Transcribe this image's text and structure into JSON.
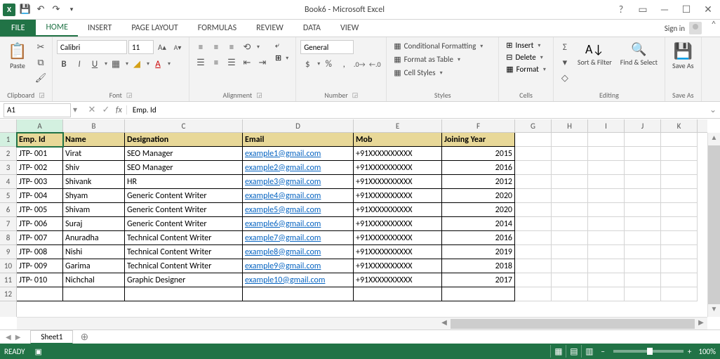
{
  "title": "Book6 - Microsoft Excel",
  "qat": {
    "excel": "X⁺",
    "undo": "↶",
    "redo": "↷"
  },
  "titleright": {
    "help": "?",
    "ribbon": "▭",
    "min": "—",
    "max": "☐",
    "close": "✕"
  },
  "tabs": {
    "file": "FILE",
    "items": [
      "HOME",
      "INSERT",
      "PAGE LAYOUT",
      "FORMULAS",
      "REVIEW",
      "DATA",
      "VIEW"
    ],
    "active": "HOME",
    "signin": "Sign in",
    "collapse": "^"
  },
  "ribbon": {
    "clipboard": {
      "paste": "Paste",
      "label": "Clipboard"
    },
    "font": {
      "name": "Calibri",
      "size": "11",
      "bold": "B",
      "italic": "I",
      "underline": "U",
      "grow": "A▴",
      "shrink": "A▾",
      "label": "Font"
    },
    "alignment": {
      "wrap": "Wrap",
      "merge": "Merge",
      "label": "Alignment"
    },
    "number": {
      "format": "General",
      "label": "Number"
    },
    "styles": {
      "cond": "Conditional Formatting",
      "table": "Format as Table",
      "cell": "Cell Styles",
      "label": "Styles"
    },
    "cells": {
      "insert": "Insert",
      "delete": "Delete",
      "format": "Format",
      "label": "Cells"
    },
    "editing": {
      "sort": "Sort & Filter",
      "find": "Find & Select",
      "label": "Editing"
    },
    "saveas": {
      "btn": "Save As",
      "label": "Save As"
    }
  },
  "formula_bar": {
    "namebox": "A1",
    "content": "Emp. Id"
  },
  "columns": [
    "A",
    "B",
    "C",
    "D",
    "E",
    "F",
    "G",
    "H",
    "I",
    "J",
    "K"
  ],
  "row_count_visible": 12,
  "headers": [
    "Emp. Id",
    "Name",
    "Designation",
    "Email",
    "Mob",
    "Joining Year"
  ],
  "rows": [
    {
      "id": "JTP- 001",
      "name": "Virat",
      "desig": "SEO Manager",
      "email": "example1@gmail.com",
      "mob": "+91XXXXXXXXXX",
      "year": "2015"
    },
    {
      "id": "JTP- 002",
      "name": "Shiv",
      "desig": "SEO Manager",
      "email": "example2@gmail.com",
      "mob": "+91XXXXXXXXXX",
      "year": "2016"
    },
    {
      "id": "JTP- 003",
      "name": "Shivank",
      "desig": "HR",
      "email": "example3@gmail.com",
      "mob": "+91XXXXXXXXXX",
      "year": "2012"
    },
    {
      "id": "JTP- 004",
      "name": "Shyam",
      "desig": "Generic Content Writer",
      "email": "example4@gmail.com",
      "mob": "+91XXXXXXXXXX",
      "year": "2020"
    },
    {
      "id": "JTP- 005",
      "name": "Shivam",
      "desig": "Generic Content Writer",
      "email": "example5@gmail.com",
      "mob": "+91XXXXXXXXXX",
      "year": "2020"
    },
    {
      "id": "JTP- 006",
      "name": "Suraj",
      "desig": "Generic Content Writer",
      "email": "example6@gmail.com",
      "mob": "+91XXXXXXXXXX",
      "year": "2014"
    },
    {
      "id": "JTP- 007",
      "name": "Anuradha",
      "desig": "Technical Content Writer",
      "email": "example7@gmail.com",
      "mob": "+91XXXXXXXXXX",
      "year": "2016"
    },
    {
      "id": "JTP- 008",
      "name": "Nishi",
      "desig": "Technical Content Writer",
      "email": "example8@gmail.com",
      "mob": "+91XXXXXXXXXX",
      "year": "2019"
    },
    {
      "id": "JTP- 009",
      "name": "Garima",
      "desig": "Technical Content Writer",
      "email": "example9@gmail.com",
      "mob": "+91XXXXXXXXXX",
      "year": "2018"
    },
    {
      "id": "JTP- 010",
      "name": "Nichchal",
      "desig": "Graphic Designer",
      "email": "example10@gmail.com",
      "mob": "+91XXXXXXXXXX",
      "year": "2017"
    }
  ],
  "sheet": {
    "name": "Sheet1",
    "add": "⊕"
  },
  "status": {
    "ready": "READY",
    "zoom": "100%",
    "minus": "−",
    "plus": "+"
  }
}
